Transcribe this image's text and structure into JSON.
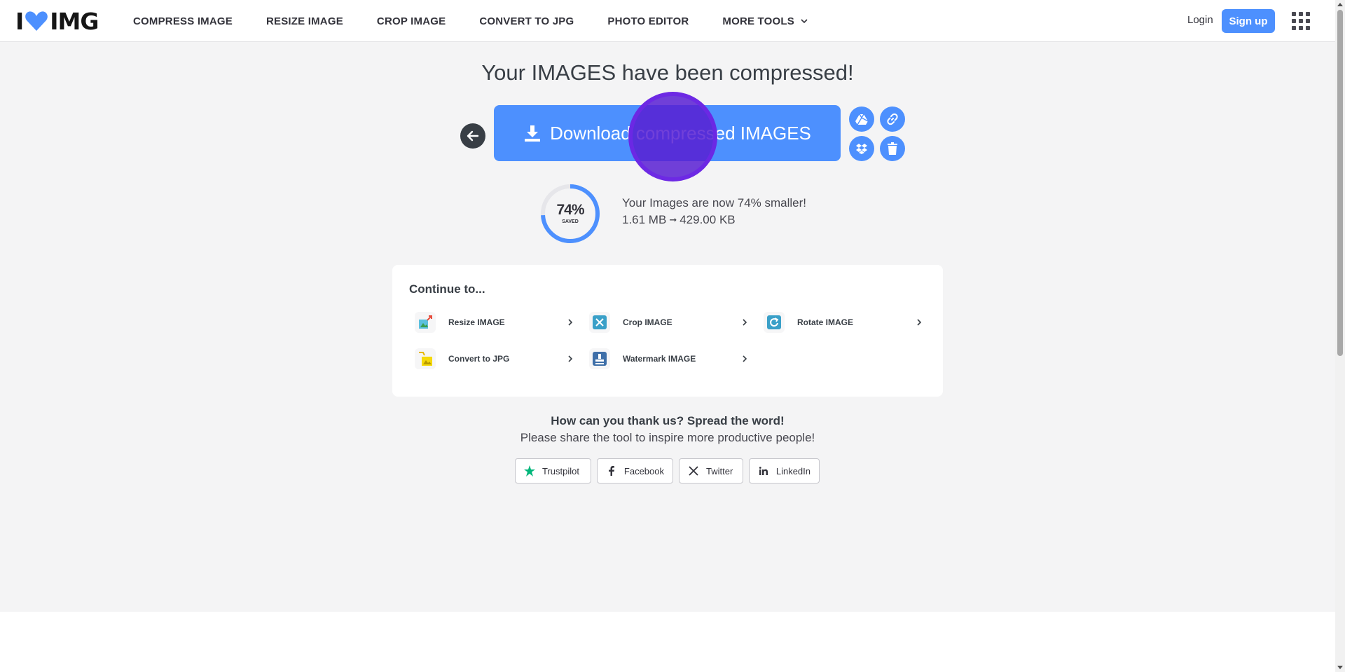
{
  "header": {
    "logo_left": "I",
    "logo_right": "IMG",
    "nav": [
      {
        "label": "COMPRESS IMAGE"
      },
      {
        "label": "RESIZE IMAGE"
      },
      {
        "label": "CROP IMAGE"
      },
      {
        "label": "CONVERT TO JPG"
      },
      {
        "label": "PHOTO EDITOR"
      },
      {
        "label": "MORE TOOLS"
      }
    ],
    "login": "Login",
    "signup": "Sign up"
  },
  "main": {
    "title": "Your IMAGES have been compressed!",
    "download_label": "Download compressed IMAGES",
    "saved_percent": 74,
    "saved_percent_label": "74%",
    "saved_sub": "SAVED",
    "saved_message": "Your Images are now 74% smaller!",
    "size_before": "1.61 MB",
    "size_arrow": "➞",
    "size_after": "429.00 KB"
  },
  "continue": {
    "title": "Continue to...",
    "tools": [
      {
        "label": "Resize IMAGE",
        "icon": "resize-icon"
      },
      {
        "label": "Crop IMAGE",
        "icon": "crop-icon"
      },
      {
        "label": "Rotate IMAGE",
        "icon": "rotate-icon"
      },
      {
        "label": "Convert to JPG",
        "icon": "convert-icon"
      },
      {
        "label": "Watermark IMAGE",
        "icon": "watermark-icon"
      }
    ]
  },
  "share": {
    "question": "How can you thank us? Spread the word!",
    "subtitle": "Please share the tool to inspire more productive people!",
    "buttons": [
      {
        "label": "Trustpilot"
      },
      {
        "label": "Facebook"
      },
      {
        "label": "Twitter"
      },
      {
        "label": "LinkedIn"
      }
    ]
  },
  "colors": {
    "brand_blue": "#4d90fe",
    "heart_blue": "#4d90fe",
    "ripple_purple": "#581ed2",
    "text_dark": "#383e45"
  }
}
